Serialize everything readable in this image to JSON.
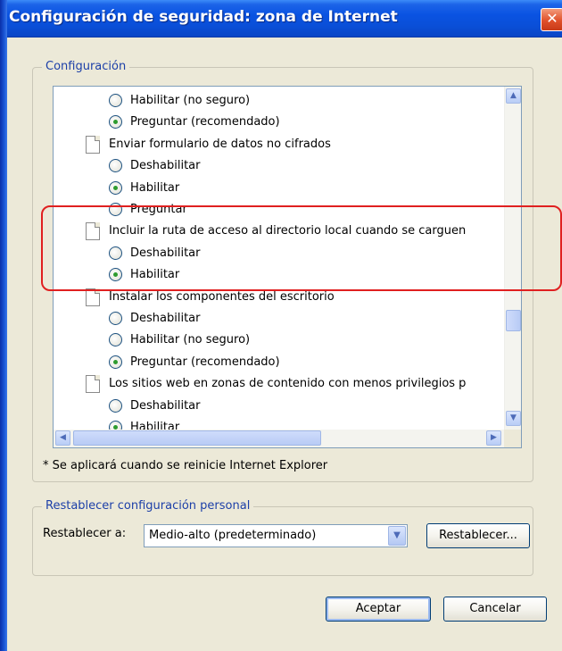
{
  "window": {
    "title": "Configuración de seguridad: zona de Internet",
    "close_glyph": "✕"
  },
  "settings_group": {
    "legend": "Configuración",
    "rows": [
      {
        "kind": "radio",
        "label": "Habilitar (no seguro)",
        "checked": false
      },
      {
        "kind": "radio",
        "label": "Preguntar (recomendado)",
        "checked": true
      },
      {
        "kind": "item",
        "label": "Enviar formulario de datos no cifrados"
      },
      {
        "kind": "radio",
        "label": "Deshabilitar",
        "checked": false
      },
      {
        "kind": "radio",
        "label": "Habilitar",
        "checked": true
      },
      {
        "kind": "radio",
        "label": "Preguntar",
        "checked": false
      },
      {
        "kind": "item",
        "label": "Incluir la ruta de acceso al directorio local cuando se carguen"
      },
      {
        "kind": "radio",
        "label": "Deshabilitar",
        "checked": false
      },
      {
        "kind": "radio",
        "label": "Habilitar",
        "checked": true
      },
      {
        "kind": "item",
        "label": "Instalar los componentes del escritorio"
      },
      {
        "kind": "radio",
        "label": "Deshabilitar",
        "checked": false
      },
      {
        "kind": "radio",
        "label": "Habilitar (no seguro)",
        "checked": false
      },
      {
        "kind": "radio",
        "label": "Preguntar (recomendado)",
        "checked": true
      },
      {
        "kind": "item",
        "label": "Los sitios web en zonas de contenido con menos privilegios p"
      },
      {
        "kind": "radio",
        "label": "Deshabilitar",
        "checked": false
      },
      {
        "kind": "radio",
        "label": "Habilitar",
        "checked": true
      }
    ],
    "note": "* Se aplicará cuando se reinicie Internet Explorer"
  },
  "reset_group": {
    "legend": "Restablecer configuración personal",
    "label": "Restablecer a:",
    "selected": "Medio-alto (predeterminado)",
    "reset_button": "Restablecer..."
  },
  "footer": {
    "ok": "Aceptar",
    "cancel": "Cancelar"
  },
  "icons": {
    "up": "▲",
    "down": "▼",
    "left": "◀",
    "right": "▶",
    "dropdown": "▼"
  },
  "colors": {
    "highlight": "#e02020",
    "radio_checked": "#2e9b2e",
    "title_bar": "#0a53e2"
  }
}
